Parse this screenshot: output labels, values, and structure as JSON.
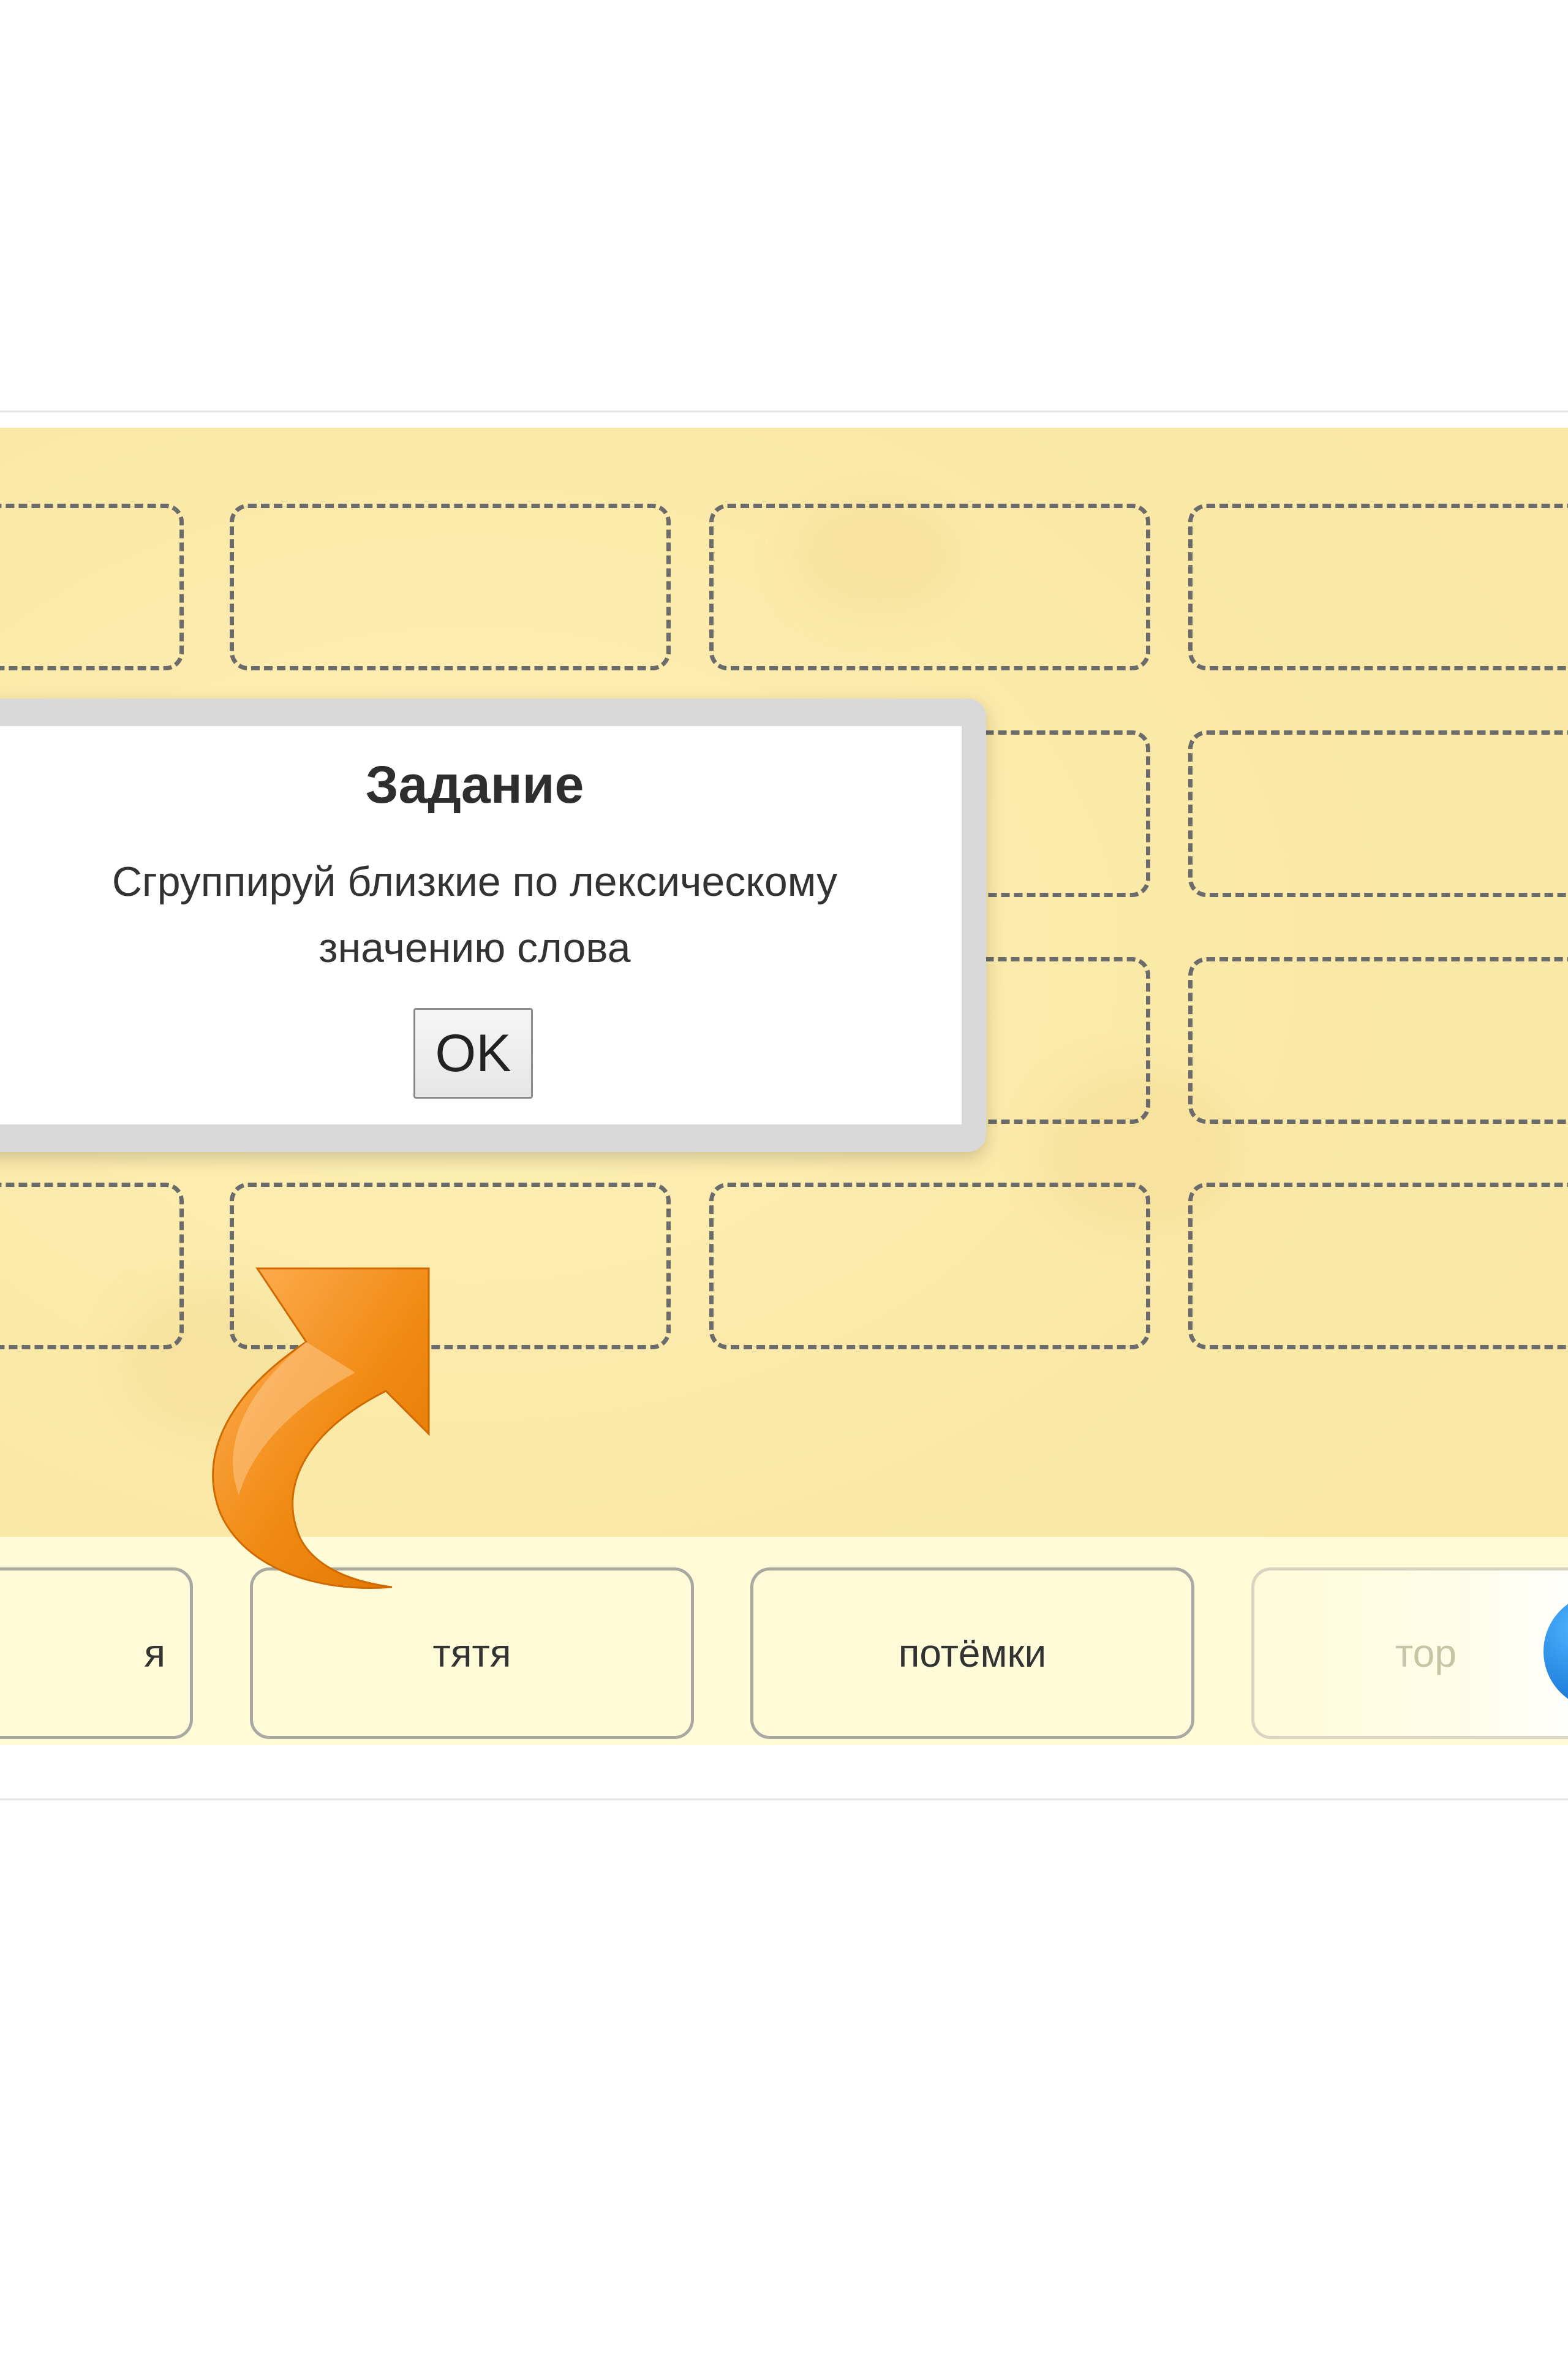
{
  "modal": {
    "title": "Задание",
    "text": "Сгруппируй близкие по лексическому значению слова",
    "ok_label": "OK"
  },
  "word_cards": [
    {
      "text": "я"
    },
    {
      "text": "тятя"
    },
    {
      "text": "потёмки"
    },
    {
      "text": "тор"
    }
  ],
  "drop_slots": {
    "rows": 4,
    "visible_columns": 4,
    "style": "dashed"
  },
  "colors": {
    "background": "#f9e6a4",
    "tray": "#fffbd6",
    "arrow": "#f0860f",
    "round_button": "#1877d6"
  },
  "icons": {
    "hint_arrow": "curved-arrow-up-right-icon",
    "round_button": "circle-button-icon"
  }
}
